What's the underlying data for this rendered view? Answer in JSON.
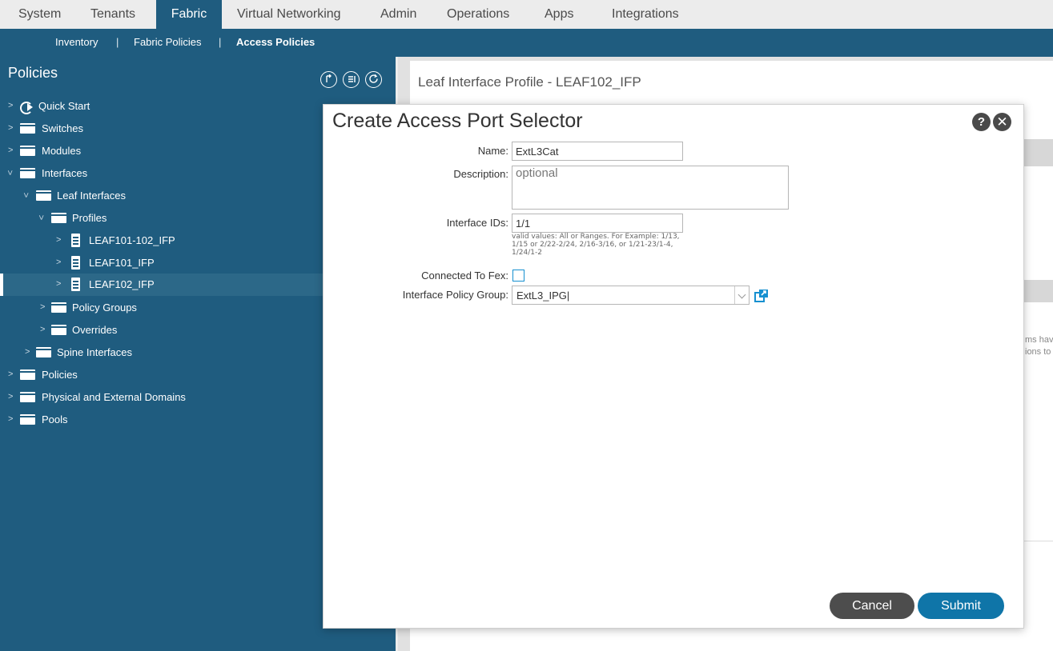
{
  "topnav": {
    "tabs": [
      "System",
      "Tenants",
      "Fabric",
      "Virtual Networking",
      "Admin",
      "Operations",
      "Apps",
      "Integrations"
    ],
    "active": "Fabric"
  },
  "subnav": {
    "items": [
      "Inventory",
      "Fabric Policies",
      "Access Policies"
    ],
    "separator": "|",
    "active": "Access Policies"
  },
  "sidebar": {
    "title": "Policies",
    "tree": [
      {
        "label": "Quick Start",
        "icon": "quick-start-icon"
      },
      {
        "label": "Switches",
        "icon": "folder-icon"
      },
      {
        "label": "Modules",
        "icon": "folder-icon"
      },
      {
        "label": "Interfaces",
        "icon": "folder-icon",
        "expanded": true
      },
      {
        "label": "Leaf Interfaces",
        "icon": "folder-icon",
        "expanded": true
      },
      {
        "label": "Profiles",
        "icon": "folder-icon",
        "expanded": true
      },
      {
        "label": "LEAF101-102_IFP",
        "icon": "document-icon"
      },
      {
        "label": "LEAF101_IFP",
        "icon": "document-icon"
      },
      {
        "label": "LEAF102_IFP",
        "icon": "document-icon",
        "selected": true
      },
      {
        "label": "Policy Groups",
        "icon": "folder-icon"
      },
      {
        "label": "Overrides",
        "icon": "folder-icon"
      },
      {
        "label": "Spine Interfaces",
        "icon": "folder-icon"
      },
      {
        "label": "Policies",
        "icon": "folder-icon"
      },
      {
        "label": "Physical and External Domains",
        "icon": "folder-icon"
      },
      {
        "label": "Pools",
        "icon": "folder-icon"
      }
    ]
  },
  "content": {
    "title": "Leaf Interface Profile - LEAF102_IFP",
    "clipped_text_1": "ms hav",
    "clipped_text_2": "ions to"
  },
  "modal": {
    "title": "Create Access Port Selector",
    "help_label": "?",
    "close_label": "✕",
    "name": {
      "label": "Name:",
      "value": "ExtL3Cat"
    },
    "description": {
      "label": "Description:",
      "placeholder": "optional",
      "value": ""
    },
    "interface_ids": {
      "label": "Interface IDs:",
      "value": "1/1",
      "hint": "valid values: All or Ranges. For Example: 1/13, 1/15 or 2/22-2/24, 2/16-3/16, or 1/21-23/1-4, 1/24/1-2"
    },
    "connected_to_fex": {
      "label": "Connected To Fex:",
      "checked": false
    },
    "interface_policy_group": {
      "label": "Interface Policy Group:",
      "value": "ExtL3_IPG|"
    },
    "cancel_label": "Cancel",
    "submit_label": "Submit"
  },
  "colors": {
    "brand_blue": "#1f5c7f",
    "submit_blue": "#0f75a8",
    "cancel_gray": "#4d4d4d",
    "link_blue": "#1690d0"
  }
}
